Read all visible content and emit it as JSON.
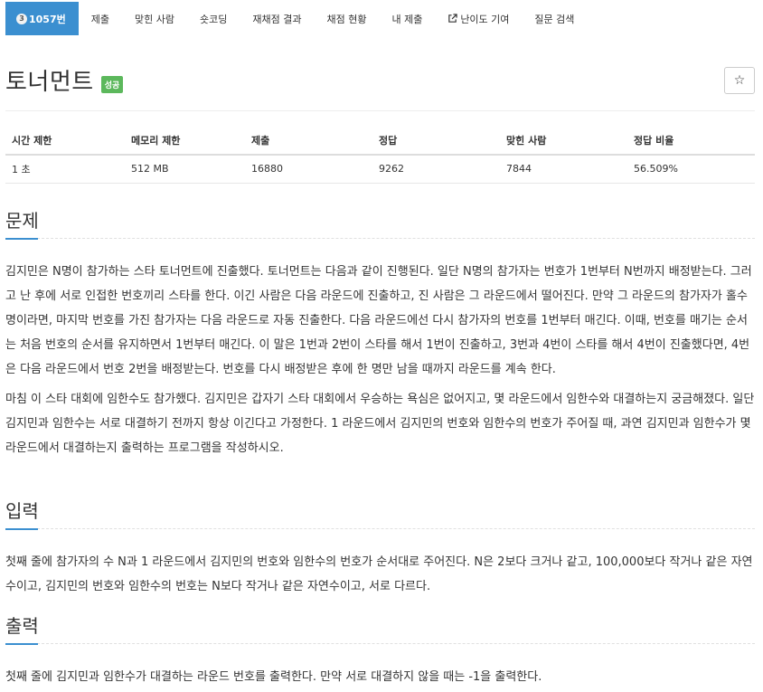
{
  "tabs": [
    {
      "tier": "3",
      "label": "1057번",
      "active": true
    },
    {
      "label": "제출"
    },
    {
      "label": "맞힌 사람"
    },
    {
      "label": "숏코딩"
    },
    {
      "label": "재채점 결과"
    },
    {
      "label": "채점 현황"
    },
    {
      "label": "내 제출"
    },
    {
      "label": "난이도 기여",
      "icon": "external-link-icon"
    },
    {
      "label": "질문 검색"
    }
  ],
  "problem": {
    "title": "토너먼트",
    "status_badge": "성공",
    "star_icon": "☆"
  },
  "info_table": {
    "headers": [
      "시간 제한",
      "메모리 제한",
      "제출",
      "정답",
      "맞힌 사람",
      "정답 비율"
    ],
    "values": [
      "1 초",
      "512 MB",
      "16880",
      "9262",
      "7844",
      "56.509%"
    ]
  },
  "sections": {
    "description": {
      "title": "문제",
      "paragraphs": [
        "김지민은 N명이 참가하는 스타 토너먼트에 진출했다. 토너먼트는 다음과 같이 진행된다. 일단 N명의 참가자는 번호가 1번부터 N번까지 배정받는다. 그러고 난 후에 서로 인접한 번호끼리 스타를 한다. 이긴 사람은 다음 라운드에 진출하고, 진 사람은 그 라운드에서 떨어진다. 만약 그 라운드의 참가자가 홀수명이라면, 마지막 번호를 가진 참가자는 다음 라운드로 자동 진출한다. 다음 라운드에선 다시 참가자의 번호를 1번부터 매긴다. 이때, 번호를 매기는 순서는 처음 번호의 순서를 유지하면서 1번부터 매긴다. 이 말은 1번과 2번이 스타를 해서 1번이 진출하고, 3번과 4번이 스타를 해서 4번이 진출했다면, 4번은 다음 라운드에서 번호 2번을 배정받는다. 번호를 다시 배정받은 후에 한 명만 남을 때까지 라운드를 계속 한다.",
        "마침 이 스타 대회에 임한수도 참가했다. 김지민은 갑자기 스타 대회에서 우승하는 욕심은 없어지고, 몇 라운드에서 임한수와 대결하는지 궁금해졌다. 일단 김지민과 임한수는 서로 대결하기 전까지 항상 이긴다고 가정한다. 1 라운드에서 김지민의 번호와 임한수의 번호가 주어질 때, 과연 김지민과 임한수가 몇 라운드에서 대결하는지 출력하는 프로그램을 작성하시오."
      ]
    },
    "input": {
      "title": "입력",
      "text": "첫째 줄에 참가자의 수 N과 1 라운드에서 김지민의 번호와 임한수의 번호가 순서대로 주어진다. N은 2보다 크거나 같고, 100,000보다 작거나 같은 자연수이고, 김지민의 번호와 임한수의 번호는 N보다 작거나 같은 자연수이고, 서로 다르다."
    },
    "output": {
      "title": "출력",
      "text": "첫째 줄에 김지민과 임한수가 대결하는 라운드 번호를 출력한다. 만약 서로 대결하지 않을 때는 -1을 출력한다."
    }
  }
}
